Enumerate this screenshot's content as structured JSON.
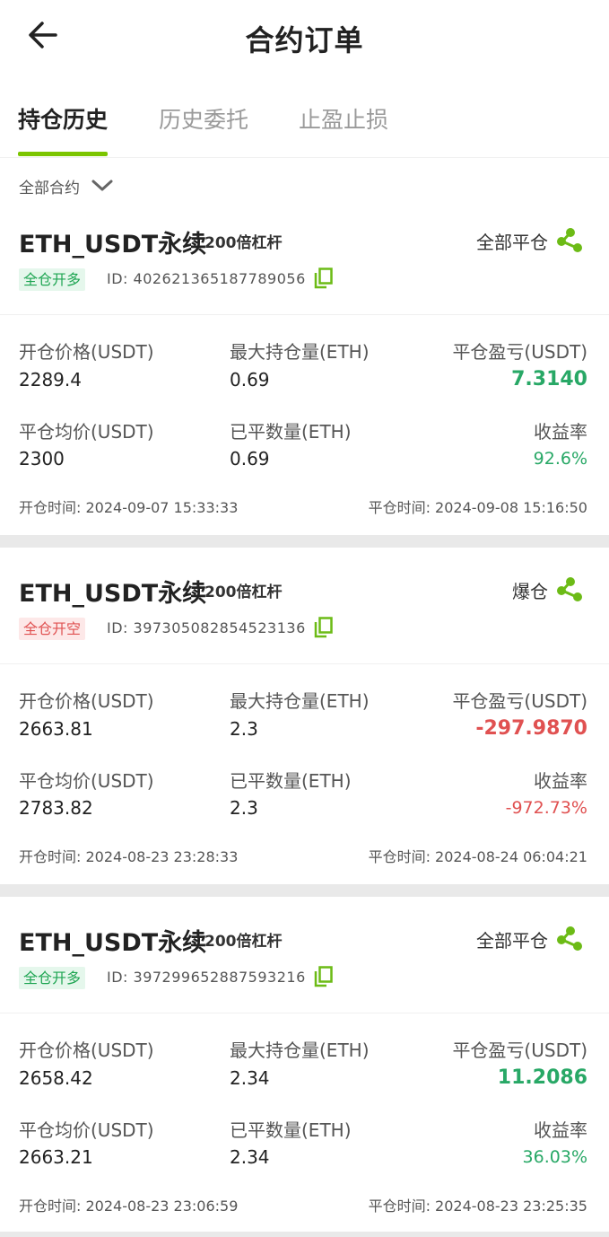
{
  "header": {
    "title": "合约订单"
  },
  "tabs": [
    {
      "label": "持仓历史"
    },
    {
      "label": "历史委托"
    },
    {
      "label": "止盈止损"
    }
  ],
  "filter": {
    "label": "全部合约"
  },
  "labels": {
    "open_price": "开仓价格(USDT)",
    "max_position": "最大持仓量(ETH)",
    "close_pnl": "平仓盈亏(USDT)",
    "close_avg": "平仓均价(USDT)",
    "closed_qty": "已平数量(ETH)",
    "return_rate": "收益率"
  },
  "colors": {
    "accent": "#7bc500",
    "profit": "#28a866",
    "loss": "#e05151"
  },
  "orders": [
    {
      "pair": "ETH_USDT永续",
      "leverage": "200倍杠杆",
      "status": "全部平仓",
      "side": "全仓开多",
      "id": "ID:  402621365187789056",
      "open_price": "2289.4",
      "max_position": "0.69",
      "pnl": "7.3140",
      "close_avg": "2300",
      "closed_qty": "0.69",
      "rate": "92.6%",
      "open_time": "开仓时间: 2024-09-07 15:33:33",
      "close_time": "平仓时间: 2024-09-08 15:16:50"
    },
    {
      "pair": "ETH_USDT永续",
      "leverage": "200倍杠杆",
      "status": "爆仓",
      "side": "全仓开空",
      "id": "ID:  397305082854523136",
      "open_price": "2663.81",
      "max_position": "2.3",
      "pnl": "-297.9870",
      "close_avg": "2783.82",
      "closed_qty": "2.3",
      "rate": "-972.73%",
      "open_time": "开仓时间: 2024-08-23 23:28:33",
      "close_time": "平仓时间: 2024-08-24 06:04:21"
    },
    {
      "pair": "ETH_USDT永续",
      "leverage": "200倍杠杆",
      "status": "全部平仓",
      "side": "全仓开多",
      "id": "ID:  397299652887593216",
      "open_price": "2658.42",
      "max_position": "2.34",
      "pnl": "11.2086",
      "close_avg": "2663.21",
      "closed_qty": "2.34",
      "rate": "36.03%",
      "open_time": "开仓时间: 2024-08-23 23:06:59",
      "close_time": "平仓时间: 2024-08-23 23:25:35"
    }
  ]
}
